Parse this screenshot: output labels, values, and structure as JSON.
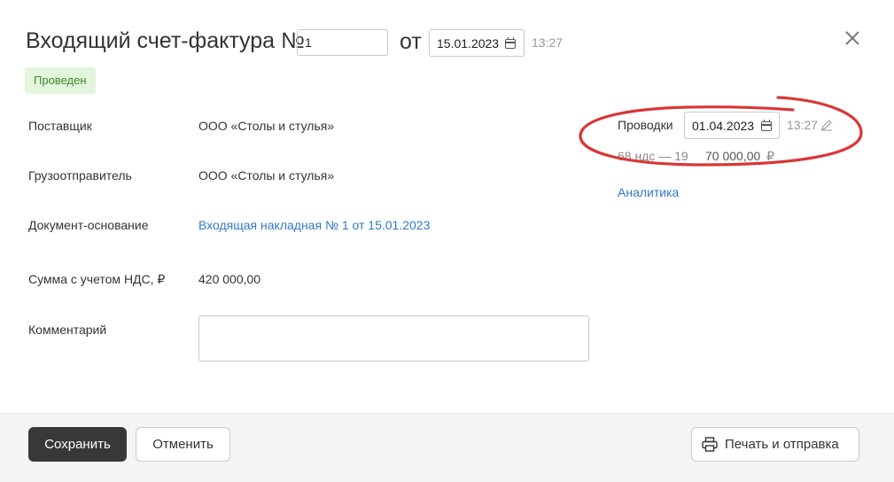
{
  "header": {
    "title": "Входящий счет-фактура №",
    "number_value": "1",
    "from_label": "от",
    "date_value": "15.01.2023",
    "time": "13:27"
  },
  "status_badge": "Проведен",
  "fields": {
    "supplier_label": "Поставщик",
    "supplier_value": "ООО «Столы и стулья»",
    "shipper_label": "Грузоотправитель",
    "shipper_value": "ООО «Столы и стулья»",
    "basis_label": "Документ-основание",
    "basis_value": "Входящая накладная № 1 от 15.01.2023",
    "sum_label": "Сумма с учетом НДС, ₽",
    "sum_value": "420 000,00",
    "comment_label": "Комментарий",
    "comment_value": ""
  },
  "postings": {
    "label": "Проводки",
    "date_value": "01.04.2023",
    "time": "13:27",
    "entry_account": "68.ндс — 19",
    "entry_amount": "70 000,00",
    "currency": "₽",
    "analytics_link": "Аналитика"
  },
  "footer": {
    "save_label": "Сохранить",
    "cancel_label": "Отменить",
    "print_label": "Печать и отправка"
  },
  "colors": {
    "accent_link": "#2f7bc8",
    "badge_bg": "#e3f5dd",
    "badge_text": "#3d8b27",
    "primary_button": "#383838",
    "annotation": "#d93636"
  },
  "icons": {
    "date_picker": "calendar-icon",
    "close": "close-icon",
    "edit": "pencil-icon",
    "print": "printer-icon"
  }
}
